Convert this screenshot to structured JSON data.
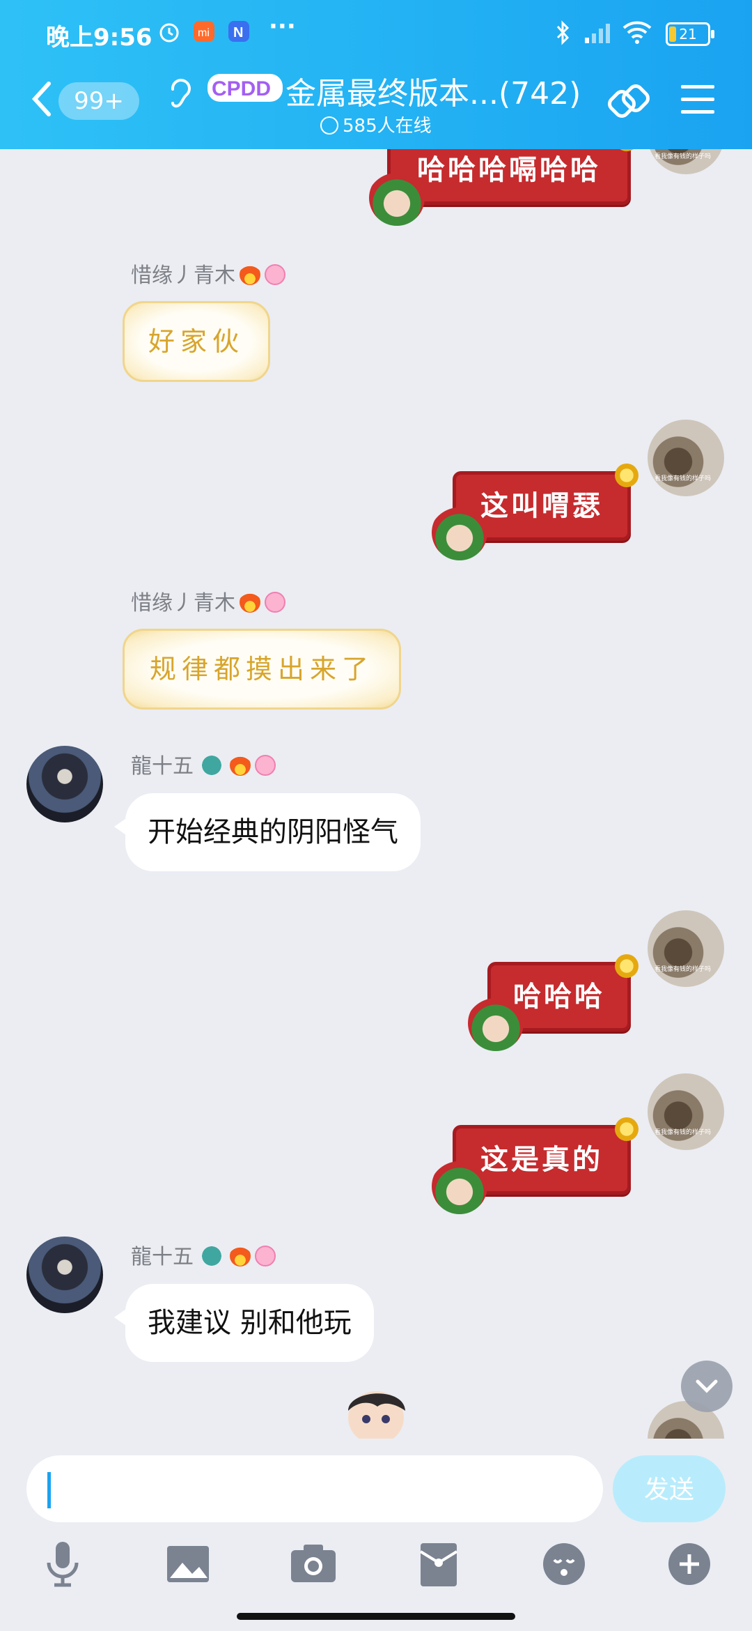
{
  "status_bar": {
    "time": "晚上9:56",
    "more": "···",
    "battery": "21"
  },
  "header": {
    "unread_count": "99+",
    "group_logo": "CPDD",
    "title": "金属最终版本...(742)",
    "online": "585人在线"
  },
  "messages": [
    {
      "side": "right",
      "style": "red-festive",
      "text": "哈哈哈嗝哈哈"
    },
    {
      "side": "left",
      "sender": "惜缘丿青木",
      "style": "gold",
      "text": "好家伙"
    },
    {
      "side": "right",
      "style": "red-festive",
      "text": "这叫喟瑟"
    },
    {
      "side": "left",
      "sender": "惜缘丿青木",
      "style": "gold",
      "text": "规律都摸出来了"
    },
    {
      "side": "left",
      "sender": "龍十五",
      "style": "plain",
      "text": "开始经典的阴阳怪气"
    },
    {
      "side": "right",
      "style": "red-festive",
      "text": "哈哈哈"
    },
    {
      "side": "right",
      "style": "red-festive",
      "text": "这是真的"
    },
    {
      "side": "left",
      "sender": "龍十五",
      "style": "plain",
      "text": "我建议 别和他玩"
    }
  ],
  "input": {
    "value": "",
    "send_label": "发送"
  },
  "toolbar": [
    "mic-icon",
    "image-icon",
    "camera-icon",
    "red-packet-icon",
    "emoji-icon",
    "plus-icon"
  ],
  "colors": {
    "header": "#22b0f3",
    "festive_red": "#c62b2e",
    "gold_text": "#d8a52c",
    "background": "#ebedf3"
  }
}
